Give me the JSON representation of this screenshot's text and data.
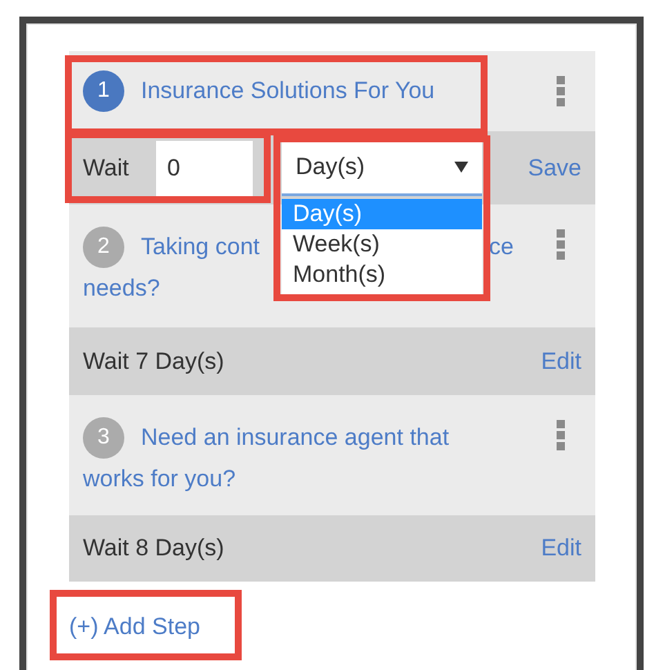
{
  "steps": [
    {
      "number": "1",
      "active": true,
      "title_lines": [
        [
          "Insurance Solutions For You"
        ]
      ],
      "wait": {
        "kind": "editing",
        "label": "Wait",
        "value": "0",
        "unit": "Day(s)",
        "action": "Save",
        "dropdown": {
          "expanded": true,
          "options": [
            {
              "label": "Day(s)",
              "selected": true
            },
            {
              "label": "Week(s)",
              "selected": false
            },
            {
              "label": "Month(s)",
              "selected": false
            }
          ]
        }
      }
    },
    {
      "number": "2",
      "active": false,
      "title_lines": [
        [
          "Taking cont",
          "ce"
        ],
        [
          "needs?"
        ]
      ],
      "wait": {
        "kind": "display",
        "text": "Wait 7 Day(s)",
        "action": "Edit"
      }
    },
    {
      "number": "3",
      "active": false,
      "title_lines": [
        [
          "Need an insurance agent that"
        ],
        [
          "works for you?"
        ]
      ],
      "wait": {
        "kind": "display",
        "text": "Wait 8 Day(s)",
        "action": "Edit"
      }
    }
  ],
  "add_step": "(+) Add Step"
}
